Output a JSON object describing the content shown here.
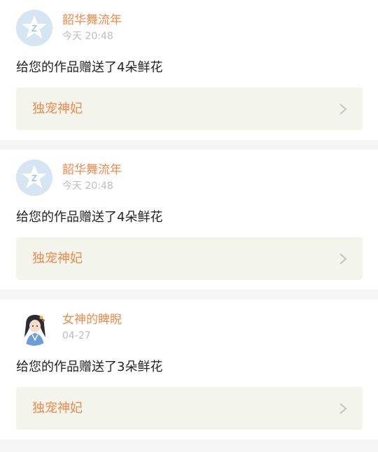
{
  "colors": {
    "accent": "#f08a4b",
    "muted": "#bdbdbd",
    "text": "#222222",
    "card_link_bg": "#f3f4ec",
    "page_bg": "#f5f5f5"
  },
  "notifications": [
    {
      "avatar": "default-star-avatar",
      "user": "韶华舞流年",
      "time": "今天 20:48",
      "message": "给您的作品赠送了4朵鲜花",
      "work_title": "独宠神妃",
      "chevron": "chevron-right-icon"
    },
    {
      "avatar": "default-star-avatar",
      "user": "韶华舞流年",
      "time": "今天 20:48",
      "message": "给您的作品赠送了4朵鲜花",
      "work_title": "独宠神妃",
      "chevron": "chevron-right-icon"
    },
    {
      "avatar": "anime-character-avatar",
      "user": "女神的睥睨",
      "time": "04-27",
      "message": "给您的作品赠送了3朵鲜花",
      "work_title": "独宠神妃",
      "chevron": "chevron-right-icon"
    }
  ]
}
